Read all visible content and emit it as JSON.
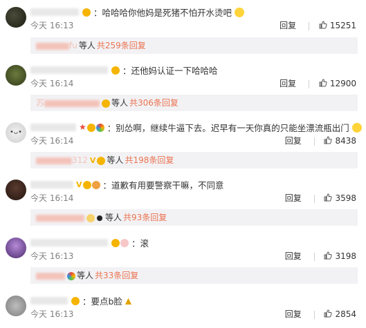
{
  "reply_label": "回复",
  "others_label": "等人",
  "comments": [
    {
      "text": "：哈哈哈你他妈是死猪不怕开水烫吧",
      "time": "今天 16:13",
      "likes": "15251",
      "sub_name": "fu",
      "sub_more": "共259条回复"
    },
    {
      "text": "：还他妈认证一下哈哈哈",
      "time": "今天 16:14",
      "likes": "12900",
      "sub_name": "苏",
      "sub_more": "共306条回复"
    },
    {
      "text": "：别怂啊，继续牛逼下去。迟早有一天你真的只能坐漂流瓶出门",
      "time": "今天 16:14",
      "likes": "8438",
      "sub_name": "312",
      "sub_more": "共198条回复"
    },
    {
      "text": "：道歉有用要警察干嘛，不同意",
      "time": "今天 16:14",
      "likes": "3598",
      "sub_name": "",
      "sub_more": "共93条回复"
    },
    {
      "text": "：滚",
      "time": "今天 16:13",
      "likes": "3198",
      "sub_name": "",
      "sub_more": "共33条回复"
    },
    {
      "text": "：要点b脸",
      "time": "今天 16:13",
      "likes": "2854"
    }
  ]
}
